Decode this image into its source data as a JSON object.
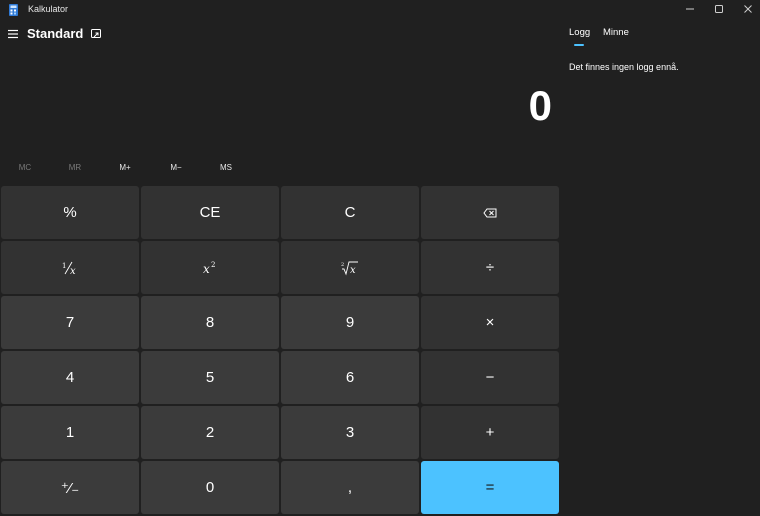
{
  "window": {
    "title": "Kalkulator"
  },
  "header": {
    "mode": "Standard"
  },
  "display": {
    "value": "0"
  },
  "memory": {
    "mc": "MC",
    "mr": "MR",
    "mplus": "M+",
    "mminus": "M−",
    "ms": "MS"
  },
  "keys": {
    "percent": "%",
    "ce": "CE",
    "c": "C",
    "divide": "÷",
    "seven": "7",
    "eight": "8",
    "nine": "9",
    "multiply": "×",
    "four": "4",
    "five": "5",
    "six": "6",
    "minus": "−",
    "one": "1",
    "two": "2",
    "three": "3",
    "plus": "+",
    "negate": "⁺⁄₋",
    "zero": "0",
    "decimal": ",",
    "equals": "="
  },
  "panel": {
    "tab_history": "Logg",
    "tab_memory": "Minne",
    "empty_message": "Det finnes ingen logg ennå."
  },
  "colors": {
    "background": "#202020",
    "key_number": "#3b3b3b",
    "key_operator": "#323232",
    "accent": "#4cc2ff"
  }
}
